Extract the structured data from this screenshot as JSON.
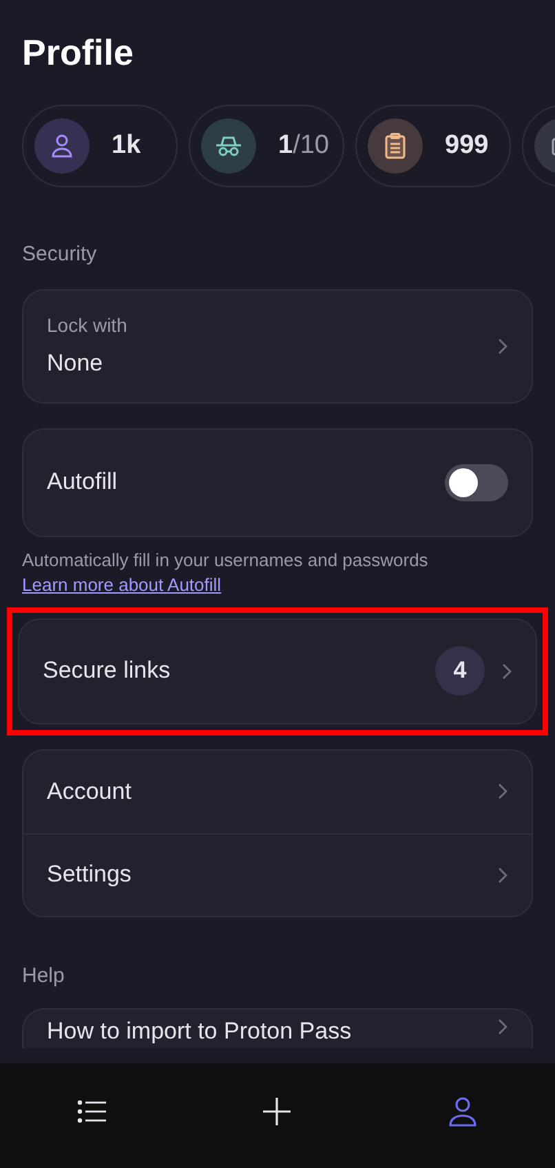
{
  "title": "Profile",
  "stats": [
    {
      "kind": "user",
      "value": "1k",
      "color": "#a78bfa"
    },
    {
      "kind": "incognito",
      "value": "1",
      "suffix": "/10",
      "color": "#7fcfc4"
    },
    {
      "kind": "clipboard",
      "value": "999",
      "color": "#f3b98a"
    },
    {
      "kind": "box",
      "color": "#9ca3af"
    }
  ],
  "security": {
    "label": "Security",
    "lock": {
      "label": "Lock with",
      "value": "None"
    },
    "autofill": {
      "label": "Autofill",
      "on": false,
      "hint": "Automatically fill in your usernames and passwords",
      "link": "Learn more about Autofill"
    },
    "secure_links": {
      "label": "Secure links",
      "count": "4",
      "highlighted": true
    }
  },
  "menu": [
    {
      "label": "Account"
    },
    {
      "label": "Settings"
    }
  ],
  "help": {
    "label": "Help",
    "items": [
      {
        "label": "How to import to Proton Pass"
      }
    ]
  },
  "tabs": [
    {
      "kind": "list",
      "selected": false
    },
    {
      "kind": "plus",
      "selected": false
    },
    {
      "kind": "user",
      "selected": true
    }
  ]
}
